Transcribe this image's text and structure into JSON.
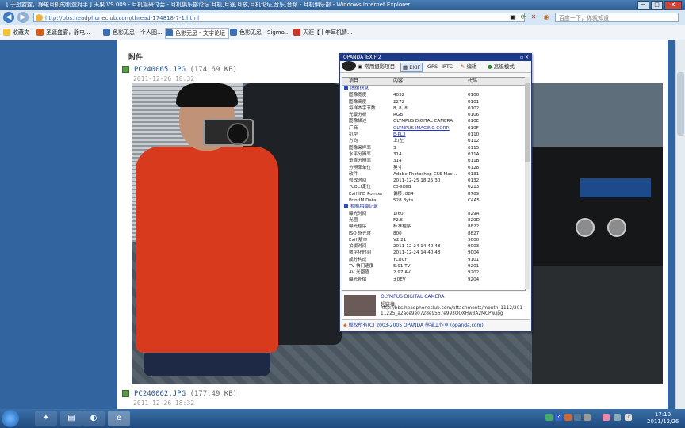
{
  "window": {
    "title": "[ 于逛露露，静电耳机的制造对手 ] 天果 VS 009 - 耳机篇研讨会 - 耳机俱乐部论坛 耳机,耳塞,耳放,耳机论坛,音乐,音频 - 耳机俱乐部 - Windows Internet Explorer",
    "min": "─",
    "max": "□",
    "close": "✕"
  },
  "address": {
    "url": "http://bbs.headphoneclub.com/thread-174818-7-1.html",
    "search_placeholder": "百度一下，你就知道"
  },
  "favorites": {
    "label": "收藏夹",
    "tabs": [
      "圣诞盛宴，静电...",
      "色影无忌 - 个人圈...",
      "色影无忌 - 文字论坛",
      "色影无忌 - Sigma...",
      "天涯【十年耳机情..."
    ]
  },
  "content": {
    "attach_header": "附件",
    "file1": {
      "name": "PC240065.JPG",
      "size": "(174.69 KB)",
      "date": "2011-12-26 18:32"
    },
    "file2": {
      "name": "PC240062.JPG",
      "size": "(177.49 KB)",
      "date": "2011-12-26 18:32"
    }
  },
  "exif": {
    "title": "OPANDA IEXIF 2",
    "toolbar": {
      "common": "常用摄影项目",
      "exif": "EXIF",
      "gps": "GPS",
      "iptc": "IPTC",
      "edit": "编辑",
      "advanced": "高级模式"
    },
    "headers": {
      "item": "项目",
      "content": "内容",
      "code": "代码"
    },
    "sections": {
      "image": "图像信息",
      "camera": "相机拍摄记录"
    },
    "image_rows": [
      {
        "item": "图像宽度",
        "content": "4032",
        "code": "0100"
      },
      {
        "item": "图像高度",
        "content": "2272",
        "code": "0101"
      },
      {
        "item": "每样本字节数",
        "content": "8, 8, 8",
        "code": "0102"
      },
      {
        "item": "光景分析",
        "content": "RGB",
        "code": "0106"
      },
      {
        "item": "图像描述",
        "content": "OLYMPUS DIGITAL CAMERA",
        "code": "010E"
      },
      {
        "item": "厂商",
        "content": "OLYMPUS IMAGING CORP.",
        "code": "010F",
        "link": true
      },
      {
        "item": "机型",
        "content": "E-PL3",
        "code": "0110",
        "link": true
      },
      {
        "item": "方向",
        "content": "上/左",
        "code": "0112"
      },
      {
        "item": "图像采样率",
        "content": "3",
        "code": "0115"
      },
      {
        "item": "水平分辨率",
        "content": "314",
        "code": "011A"
      },
      {
        "item": "垂直分辨率",
        "content": "314",
        "code": "011B"
      },
      {
        "item": "分辨率单位",
        "content": "英寸",
        "code": "0128"
      },
      {
        "item": "软件",
        "content": "Adobe Photoshop CS5 Mac...",
        "code": "0131"
      },
      {
        "item": "修改时间",
        "content": "2011-12-25 18:25:30",
        "code": "0132"
      },
      {
        "item": "YCbCr定位",
        "content": "co-sited",
        "code": "0213"
      },
      {
        "item": "Exif IFD Pointer",
        "content": "偏移: 884",
        "code": "8769"
      },
      {
        "item": "PrintIM Data",
        "content": "528 Byte",
        "code": "C4A5"
      }
    ],
    "camera_rows": [
      {
        "item": "曝光时间",
        "content": "1/60\"",
        "code": "829A"
      },
      {
        "item": "光圈",
        "content": "F2.6",
        "code": "829D"
      },
      {
        "item": "曝光程序",
        "content": "标准程序",
        "code": "8822"
      },
      {
        "item": "ISO 感光度",
        "content": "800",
        "code": "8827"
      },
      {
        "item": "Exif 版本",
        "content": "V2.21",
        "code": "9000"
      },
      {
        "item": "拍摄时间",
        "content": "2011-12-24 14:40:48",
        "code": "9003"
      },
      {
        "item": "数字化时间",
        "content": "2011-12-24 14:40:48",
        "code": "9004"
      },
      {
        "item": "成分构成",
        "content": "YCbCr",
        "code": "9101"
      },
      {
        "item": "TV 快门速度",
        "content": "5.91 TV",
        "code": "9201"
      },
      {
        "item": "AV 光圈值",
        "content": "2.97 AV",
        "code": "9202"
      },
      {
        "item": "曝光补偿",
        "content": "±0EV",
        "code": "9204"
      }
    ],
    "info": {
      "camera": "OLYMPUS DIGITAL CAMERA",
      "path_label": "超链接:",
      "path": "http://bbs.headphoneclub.com/attachments/month_1112/20111225_a2ace9e0728e9567e993OOXHw8A2MCPw.jpg"
    },
    "footer": "版权所有(C) 2003-2005 OPANDA 熊猫工作室 (opanda.com)"
  },
  "taskbar": {
    "time": "17:10",
    "date": "2011/12/26"
  }
}
